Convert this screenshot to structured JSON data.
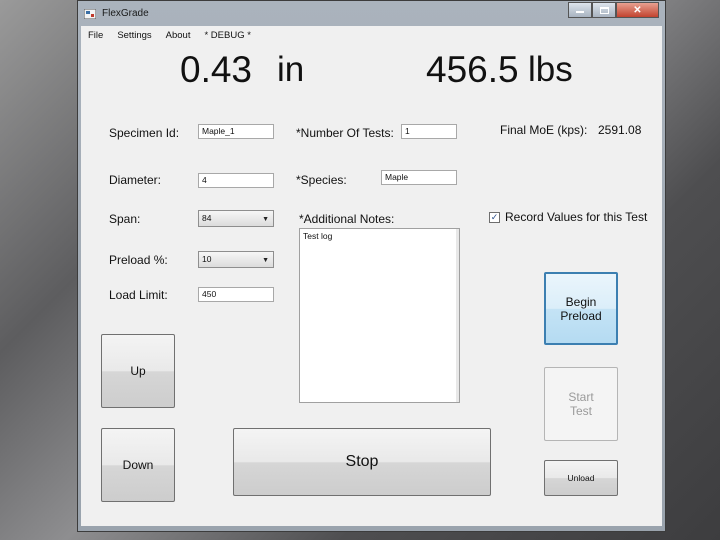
{
  "window": {
    "title": "FlexGrade",
    "close_glyph": "✕"
  },
  "menu": [
    "File",
    "Settings",
    "About",
    "* DEBUG *"
  ],
  "readout": {
    "displacement_value": "0.43",
    "displacement_unit": "in",
    "load_value": "456.5",
    "load_unit": "lbs"
  },
  "fields": {
    "specimen_id": {
      "label": "Specimen Id:",
      "value": "Maple_1"
    },
    "diameter": {
      "label": "Diameter:",
      "value": "4"
    },
    "span": {
      "label": "Span:",
      "value": "84"
    },
    "preload": {
      "label": "Preload %:",
      "value": "10"
    },
    "load_limit": {
      "label": "Load Limit:",
      "value": "450"
    },
    "num_tests": {
      "label": "*Number Of Tests:",
      "value": "1"
    },
    "species": {
      "label": "*Species:",
      "value": "Maple"
    },
    "notes": {
      "label": "*Additional Notes:",
      "value": "Test log"
    }
  },
  "result": {
    "label": "Final MoE (kps):",
    "value": "2591.08"
  },
  "record": {
    "label": "Record Values for this Test",
    "checked": true,
    "check_glyph": "✓"
  },
  "buttons": {
    "up": "Up",
    "down": "Down",
    "stop": "Stop",
    "begin_preload_line1": "Begin",
    "begin_preload_line2": "Preload",
    "start_test_line1": "Start",
    "start_test_line2": "Test",
    "unload": "Unload"
  },
  "icons": {
    "dropdown": "chevron-down-icon",
    "app": "app-icon"
  }
}
